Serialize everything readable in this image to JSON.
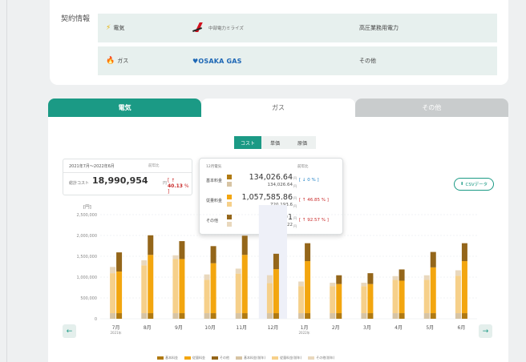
{
  "contract": {
    "title": "契約情報",
    "rows": [
      {
        "utility_label": "電気",
        "icon": "bolt-icon",
        "provider": "中部電力ミライズ",
        "provider_logo": "chubu-logo",
        "plan": "高圧業務用電力"
      },
      {
        "utility_label": "ガス",
        "icon": "flame-icon",
        "provider": "OSAKA GAS",
        "provider_logo": "osaka-gas-logo",
        "plan": "その他"
      }
    ]
  },
  "tabs": [
    {
      "label": "電気",
      "active": true
    },
    {
      "label": "ガス",
      "active": false
    },
    {
      "label": "その他",
      "active": false
    }
  ],
  "segment": [
    {
      "label": "コスト",
      "active": true
    },
    {
      "label": "単価",
      "active": false
    },
    {
      "label": "原価",
      "active": false
    }
  ],
  "summary": {
    "period": "2021年7月〜2022年6月",
    "compare_header": "前年比",
    "total_label": "総計コスト",
    "total_value": "18,990,954",
    "unit": "円",
    "change": "40.13",
    "change_prefix": "[ ↑",
    "change_suffix": "% ]"
  },
  "popover": {
    "header_left": "12月電気",
    "header_right": "前年比",
    "rows": [
      {
        "label": "基本料金",
        "current": "134,026.64",
        "previous": "134,026.64",
        "unit": "円",
        "change": "[ ↓ 0 % ]",
        "trend": "flat"
      },
      {
        "label": "従量料金",
        "current": "1,057,585.86",
        "previous": "720,193.6",
        "unit": "円",
        "change": "[ ↑ 46.85 % ]",
        "trend": "up"
      },
      {
        "label": "その他",
        "current": "369,001",
        "previous": "191,622",
        "unit": "円",
        "change": "[ ↑ 92.57 % ]",
        "trend": "up"
      }
    ]
  },
  "csv_button": {
    "label": "CSVデータ",
    "icon": "download-icon"
  },
  "colors": {
    "accent": "#1b9a85",
    "base_current": "#b07a12",
    "usage_current": "#f3a60f",
    "other_current": "#94661a",
    "base_prev": "#d7c4a4",
    "usage_prev": "#f6d08a",
    "other_prev": "#e9d8bd"
  },
  "chart_data": {
    "type": "bar",
    "ylabel": "[円]",
    "ylim": [
      0,
      2500000
    ],
    "yticks": [
      "2,500,000",
      "2,000,000",
      "1,500,000",
      "1,000,000",
      "500,000",
      "0"
    ],
    "categories": [
      "7月",
      "8月",
      "9月",
      "10月",
      "11月",
      "12月",
      "1月",
      "2月",
      "3月",
      "4月",
      "5月",
      "6月"
    ],
    "category_sublabels": [
      "2021年",
      "",
      "",
      "",
      "",
      "",
      "2022年",
      "",
      "",
      "",
      "",
      ""
    ],
    "highlight_index": 5,
    "series": [
      {
        "name": "基本料金",
        "stack": "current",
        "values": [
          134000,
          134000,
          134000,
          134000,
          134000,
          134026,
          134000,
          134000,
          134000,
          134000,
          134000,
          134000
        ]
      },
      {
        "name": "従量料金",
        "stack": "current",
        "values": [
          1000000,
          1400000,
          1300000,
          1200000,
          1400000,
          1057586,
          1250000,
          700000,
          700000,
          780000,
          1100000,
          1250000
        ]
      },
      {
        "name": "その他",
        "stack": "current",
        "values": [
          460000,
          470000,
          430000,
          410000,
          460000,
          369001,
          430000,
          210000,
          260000,
          270000,
          370000,
          430000
        ]
      },
      {
        "name": "基本料金(前年)",
        "stack": "previous",
        "values": [
          134000,
          134000,
          134000,
          134000,
          134000,
          134027,
          134000,
          134000,
          134000,
          134000,
          134000,
          134000
        ]
      },
      {
        "name": "従量料金(前年)",
        "stack": "previous",
        "values": [
          960000,
          1150000,
          1300000,
          800000,
          950000,
          720194,
          650000,
          650000,
          650000,
          800000,
          800000,
          900000
        ]
      },
      {
        "name": "その他(前年)",
        "stack": "previous",
        "values": [
          150000,
          120000,
          90000,
          130000,
          120000,
          191622,
          110000,
          80000,
          80000,
          90000,
          110000,
          130000
        ]
      }
    ]
  },
  "legend": [
    "基本料金",
    "従量料金",
    "その他",
    "基本料金(前年)",
    "従量料金(前年)",
    "その他(前年)"
  ]
}
